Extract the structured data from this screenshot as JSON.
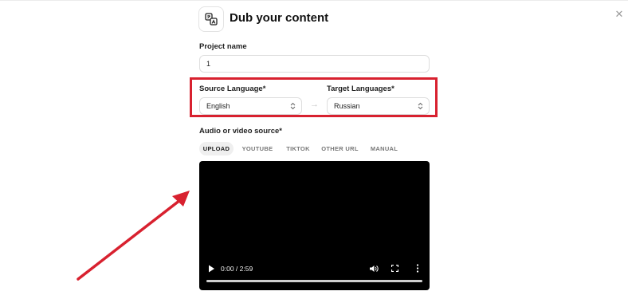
{
  "header": {
    "title": "Dub your content"
  },
  "project": {
    "label": "Project name",
    "value": "1"
  },
  "languages": {
    "source_label": "Source Language*",
    "source_value": "English",
    "target_label": "Target Languages*",
    "target_value": "Russian"
  },
  "source": {
    "label": "Audio or video source*",
    "tabs": [
      "UPLOAD",
      "YOUTUBE",
      "TIKTOK",
      "OTHER URL",
      "MANUAL"
    ],
    "active_tab": "UPLOAD"
  },
  "player": {
    "time": "0:00 / 2:59",
    "progress": 1.0
  },
  "colors": {
    "highlight": "#d8212f",
    "arrow": "#d8212f"
  },
  "icons": [
    "translate-icon",
    "close-icon",
    "chevron-updown-icon",
    "arrow-right-icon",
    "play-icon",
    "volume-icon",
    "fullscreen-icon",
    "more-options-icon"
  ]
}
